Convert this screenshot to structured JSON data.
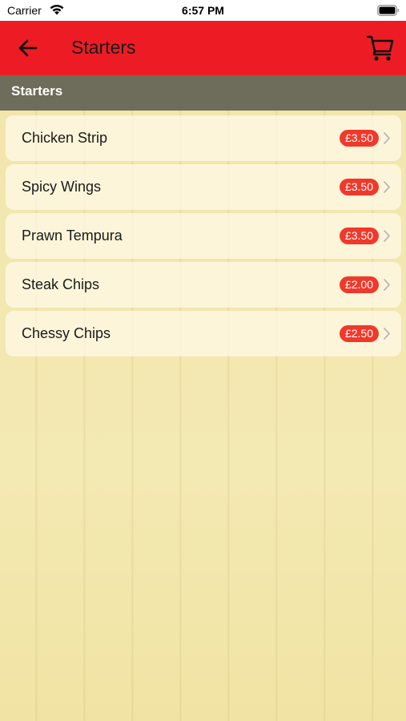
{
  "status_bar": {
    "carrier": "Carrier",
    "time": "6:57 PM",
    "icons": [
      "wifi-icon",
      "battery-icon"
    ]
  },
  "nav_bar": {
    "title": "Starters",
    "background_color": "#ed1c24",
    "icons": [
      "back-arrow-icon",
      "cart-icon"
    ]
  },
  "section": {
    "title": "Starters",
    "background_color": "#6e6c5a"
  },
  "menu_items": [
    {
      "name": "Chicken Strip",
      "price": "£3.50"
    },
    {
      "name": "Spicy Wings",
      "price": "£3.50"
    },
    {
      "name": "Prawn Tempura",
      "price": "£3.50"
    },
    {
      "name": "Steak Chips",
      "price": "£2.00"
    },
    {
      "name": "Chessy Chips",
      "price": "£2.50"
    }
  ],
  "colors": {
    "price_badge": "#f0392b",
    "background": "#f1e4a6"
  }
}
